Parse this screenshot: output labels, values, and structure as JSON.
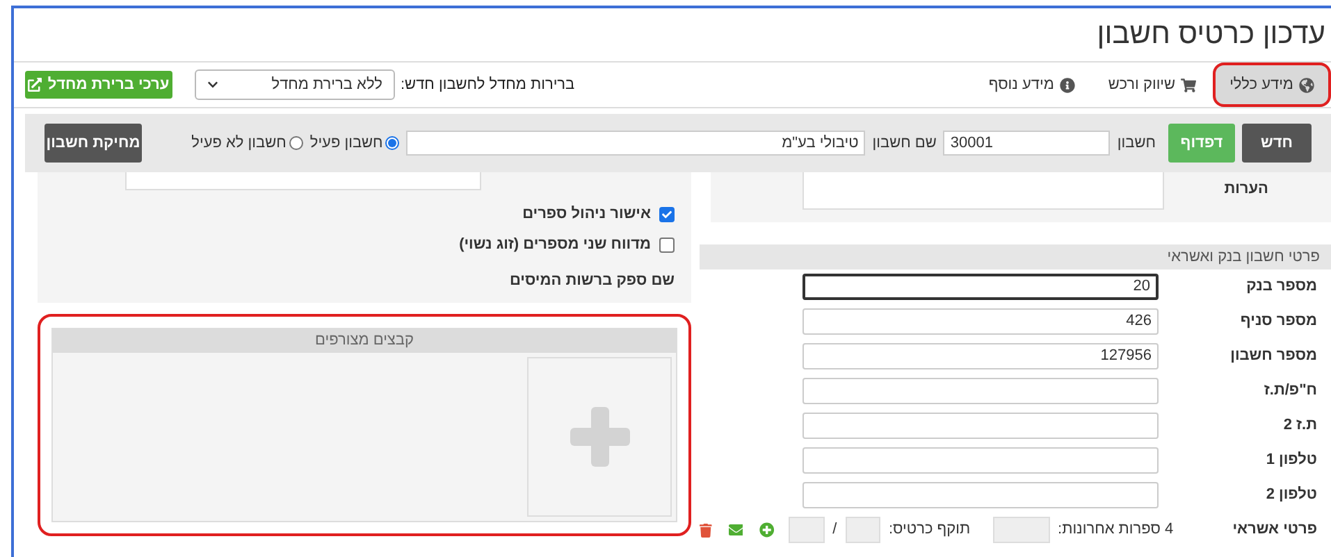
{
  "page_title": "עדכון כרטיס חשבון",
  "tabs": [
    {
      "label": "מידע כללי",
      "selected": true,
      "highlighted": true
    },
    {
      "label": "שיווק ורכש",
      "selected": false,
      "highlighted": false
    },
    {
      "label": "מידע נוסף",
      "selected": false,
      "highlighted": false
    }
  ],
  "defaults": {
    "label": "ברירות מחדל לחשבון חדש:",
    "select_value": "ללא ברירת מחדל",
    "button": "ערכי ברירת מחדל"
  },
  "toolbar": {
    "new_button": "חדש",
    "browse_button": "דפדוף",
    "account_label": "חשבון",
    "account_value": "30001",
    "name_label": "שם חשבון",
    "name_value": "טיבולי בע\"מ",
    "status_options": [
      {
        "label": "חשבון פעיל",
        "selected": true
      },
      {
        "label": "חשבון לא פעיל",
        "selected": false
      }
    ],
    "delete_button": "מחיקת חשבון"
  },
  "notes": {
    "label": "הערות"
  },
  "bank_section": {
    "title": "פרטי חשבון בנק ואשראי",
    "fields": [
      {
        "label": "מספר בנק",
        "value": "20",
        "focused": true
      },
      {
        "label": "מספר סניף",
        "value": "426",
        "focused": false
      },
      {
        "label": "מספר חשבון",
        "value": "127956",
        "focused": false
      },
      {
        "label": "ח\"פ/ת.ז",
        "focused": false
      },
      {
        "label": "ת.ז 2",
        "focused": false
      },
      {
        "label": "טלפון 1",
        "focused": false
      },
      {
        "label": "טלפון 2",
        "focused": false
      }
    ],
    "credit": {
      "label": "פרטי אשראי",
      "last_digits_label": "4 ספרות אחרונות:",
      "expiry_label": "תוקף כרטיס:",
      "separator": "/"
    }
  },
  "options": {
    "checkboxes": [
      {
        "label": "אישור ניהול ספרים",
        "checked": true
      },
      {
        "label": "מדווח שני מספרים (זוג נשוי)",
        "checked": false
      }
    ],
    "tax_supplier_label": "שם ספק ברשות המיסים"
  },
  "attachments": {
    "title": "קבצים מצורפים",
    "highlighted": true
  }
}
